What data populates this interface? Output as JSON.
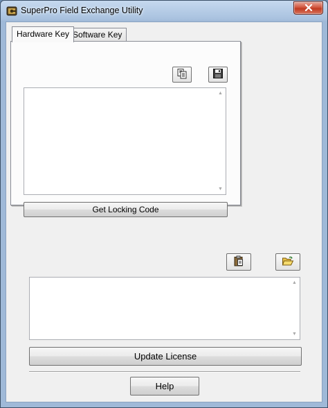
{
  "window": {
    "title": "SuperPro Field Exchange Utility",
    "close_symbol": "✕"
  },
  "tabs": [
    {
      "label": "Hardware Key",
      "active": true
    },
    {
      "label": "Software Key",
      "active": false
    }
  ],
  "hardware_panel": {
    "copy_button_icon": "copy-icon",
    "save_button_icon": "save-floppy-icon",
    "locking_code_text": "",
    "get_locking_code_label": "Get Locking Code"
  },
  "license_section": {
    "paste_button_icon": "paste-clipboard-icon",
    "open_button_icon": "open-folder-icon",
    "license_text": "",
    "update_license_label": "Update License"
  },
  "help_label": "Help",
  "scroll_up_symbol": "▲",
  "scroll_down_symbol": "▼",
  "colors": {
    "titlebar": "#a9c2df",
    "close_button": "#c13b22",
    "client_background": "#f0f0f0"
  }
}
